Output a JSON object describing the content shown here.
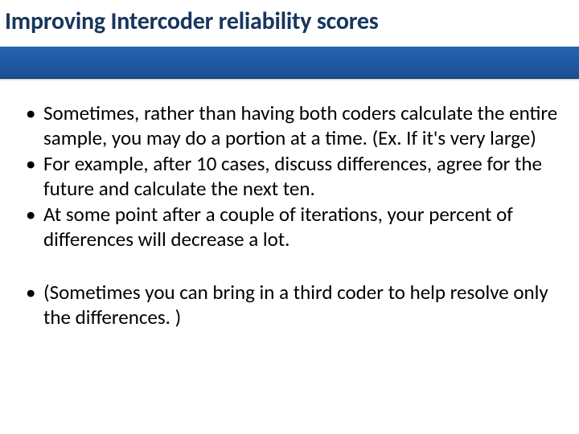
{
  "slide": {
    "title": "Improving Intercoder reliability scores",
    "bullets": [
      "Sometimes, rather than having both coders calculate the entire sample, you may do a portion at a time.  (Ex. If it's very large)",
      "For example, after 10 cases, discuss differences, agree for the future and calculate the next ten.",
      "At some point after a couple of iterations, your percent of differences will decrease a lot.",
      "(Sometimes you can bring in a third coder to help resolve only the differences. )"
    ]
  }
}
